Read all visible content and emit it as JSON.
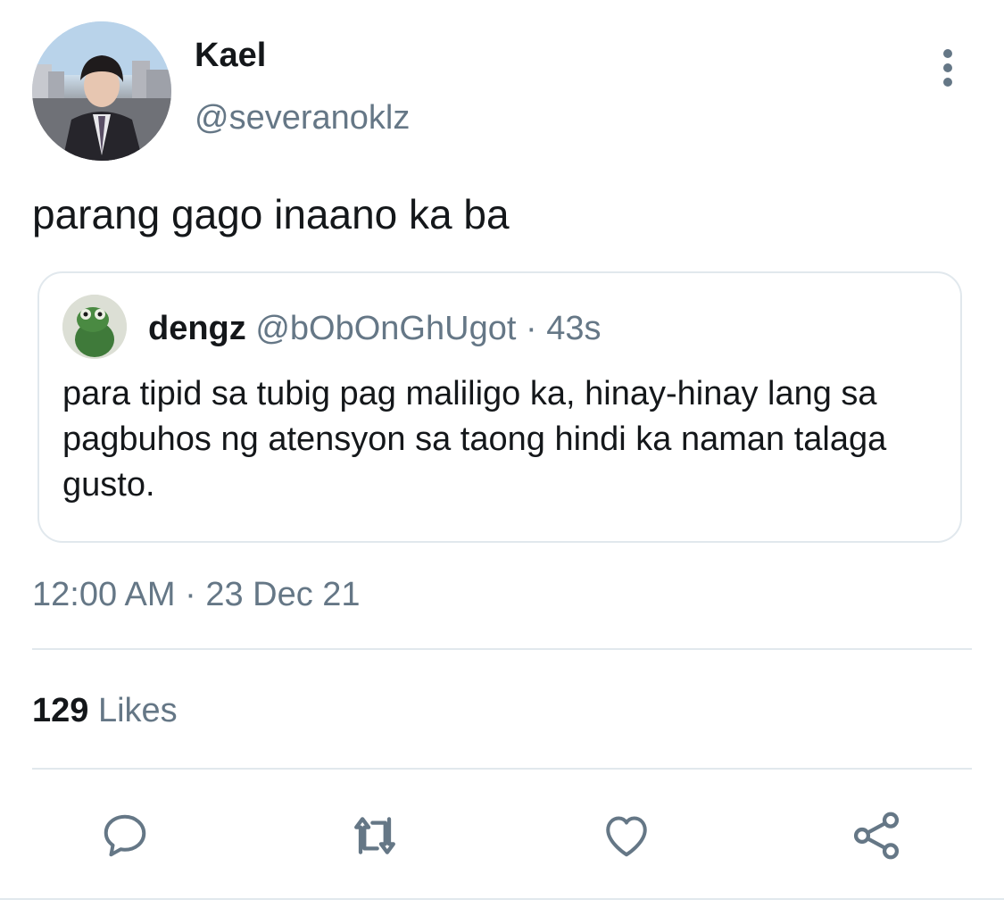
{
  "author": {
    "name": "Kael",
    "handle": "@severanoklz"
  },
  "tweet": {
    "text": "parang gago inaano ka ba",
    "timestamp": "12:00 AM · 23 Dec 21"
  },
  "quoted_tweet": {
    "name": "dengz",
    "handle": "@bObOnGhUgot",
    "separator": "·",
    "age": "43s",
    "text": "para tipid sa tubig pag maliligo ka, hinay-hinay lang sa pagbuhos ng atensyon sa taong hindi ka naman talaga gusto."
  },
  "stats": {
    "likes_count": "129",
    "likes_label": "Likes"
  },
  "actions": [
    {
      "icon": "reply-icon"
    },
    {
      "icon": "retweet-icon"
    },
    {
      "icon": "heart-icon"
    },
    {
      "icon": "share-icon"
    }
  ],
  "colors": {
    "text": "#14171a",
    "secondary": "#657786",
    "border": "#e1e8ed"
  }
}
